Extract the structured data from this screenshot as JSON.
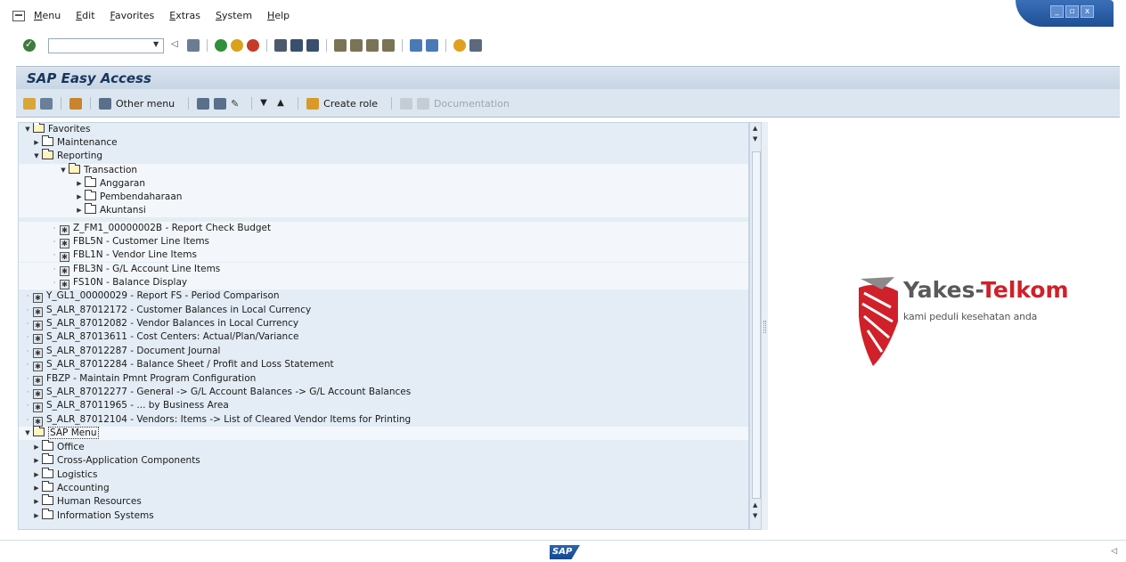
{
  "menubar": {
    "items": [
      "Menu",
      "Edit",
      "Favorites",
      "Extras",
      "System",
      "Help"
    ]
  },
  "window_controls": [
    "_",
    "▫",
    "x"
  ],
  "stdbar": {
    "command_value": ""
  },
  "title": "SAP Easy Access",
  "apptoolbar": {
    "other_menu": "Other menu",
    "create_role": "Create role",
    "documentation": "Documentation"
  },
  "tree": {
    "favorites": "Favorites",
    "maintenance": "Maintenance",
    "reporting": "Reporting",
    "transaction": "Transaction",
    "anggaran": "Anggaran",
    "pembendaharaan": "Pembendaharaan",
    "akuntansi": "Akuntansi",
    "tx_items": [
      "Z_FM1_00000002B - Report Check Budget",
      "FBL5N - Customer Line Items",
      "FBL1N - Vendor Line Items",
      "FBL3N - G/L Account Line Items",
      "FS10N - Balance Display"
    ],
    "report_items": [
      "Y_GL1_00000029 - Report FS - Period Comparison",
      "S_ALR_87012172 - Customer Balances in Local Currency",
      "S_ALR_87012082 - Vendor Balances in Local Currency",
      "S_ALR_87013611 - Cost Centers: Actual/Plan/Variance",
      "S_ALR_87012287 - Document Journal",
      "S_ALR_87012284 - Balance Sheet / Profit and Loss Statement",
      "FBZP - Maintain Pmnt Program Configuration",
      "S_ALR_87012277 - General -> G/L Account Balances -> G/L Account Balances",
      "S_ALR_87011965 - ... by Business Area",
      "S_ALR_87012104 - Vendors: Items -> List of Cleared Vendor Items for Printing"
    ],
    "sap_menu": "SAP Menu",
    "sap_menu_items": [
      "Office",
      "Cross-Application Components",
      "Logistics",
      "Accounting",
      "Human Resources",
      "Information Systems"
    ]
  },
  "logo": {
    "name_part1": "Yakes-",
    "name_part2": "Telkom",
    "tagline": "kami peduli kesehatan anda",
    "colors": {
      "red": "#d0202a",
      "gray": "#5a5a5a"
    }
  },
  "statusbar": {
    "sap_logo": "SAP"
  }
}
